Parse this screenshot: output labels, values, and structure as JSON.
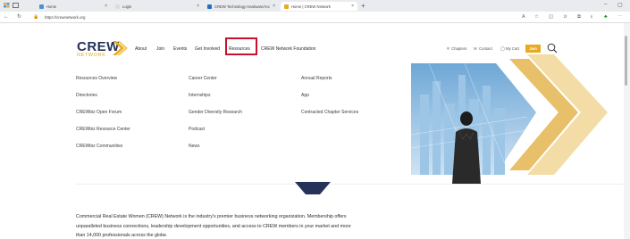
{
  "browser": {
    "tabs": [
      {
        "label": "Home"
      },
      {
        "label": "Login"
      },
      {
        "label": "CREW Technology Hardware/Acces"
      },
      {
        "label": "Home | CREW Network"
      }
    ],
    "new_tab_label": "+",
    "url": "https://crewnetwork.org",
    "window": {
      "minimize": "–",
      "maximize": "▢"
    }
  },
  "site": {
    "logo": {
      "name": "CREW",
      "sub": "NETWORK"
    },
    "nav": {
      "about": "About",
      "join": "Join",
      "events": "Events",
      "get_involved": "Get Involved",
      "resources": "Resources",
      "foundation": "CREW Network Foundation"
    },
    "utility": {
      "chapters": "Chapters",
      "contact": "Contact",
      "cart": "My Cart",
      "join_button": "Join"
    },
    "mega_menu": {
      "col1": [
        "Resources Overview",
        "Directories",
        "CREWbiz Open Forum",
        "CREWbiz Resource Center",
        "CREWbiz Communities"
      ],
      "col2": [
        "Career Center",
        "Internships",
        "Gender Diversity Research",
        "Podcast",
        "News"
      ],
      "col3": [
        "Annual Reports",
        "App",
        "Contracted Chapter Services"
      ]
    },
    "intro": {
      "line1": "Commercial Real Estate Women (CREW) Network is the industry's premier business networking organization. Membership offers",
      "line2": "unparalleled business connections, leadership development opportunities, and access to CREW members in your market and more",
      "line3": "than 14,000 professionals across the globe."
    }
  },
  "colors": {
    "brand_navy": "#25335a",
    "brand_gold": "#e8aa22",
    "highlight_red": "#c8102e"
  },
  "icons": [
    "search-icon",
    "map-pin-icon",
    "mail-icon",
    "person-icon",
    "back-icon",
    "refresh-icon",
    "lock-icon",
    "star-icon",
    "download-icon",
    "more-icon"
  ]
}
